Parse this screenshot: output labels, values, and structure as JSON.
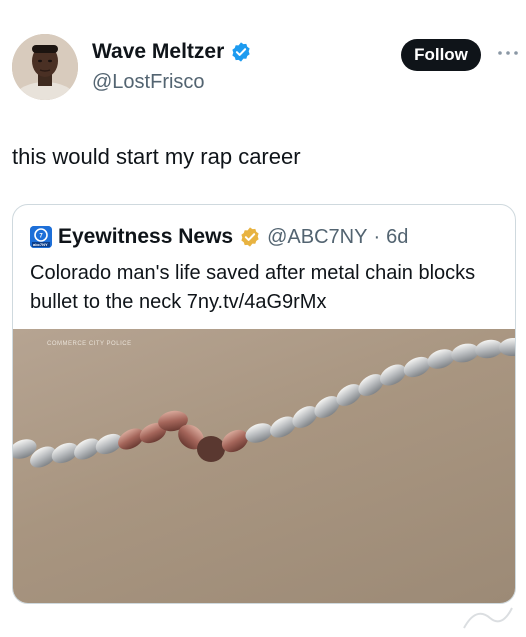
{
  "author": {
    "display_name": "Wave Meltzer",
    "handle": "@LostFrisco",
    "verified": true,
    "avatar": "profile-photo"
  },
  "actions": {
    "follow_label": "Follow",
    "more_icon": "more-horizontal-icon"
  },
  "tweet": {
    "text": "this would start my rap career"
  },
  "quote": {
    "logo_text": "abc7NY",
    "display_name": "Eyewitness News",
    "handle": "@ABC7NY",
    "separator": "·",
    "time": "6d",
    "text": "Colorado man's life saved after metal chain blocks bullet to the neck 7ny.tv/4aG9rMx",
    "media": {
      "description_icon": "chain-photo",
      "watermark": "COMMERCE CITY POLICE"
    }
  },
  "colors": {
    "verified_blue": "#1d9bf0",
    "gold_badge": "#e8b341",
    "follow_bg": "#0f1419",
    "handle_gray": "#536471"
  }
}
